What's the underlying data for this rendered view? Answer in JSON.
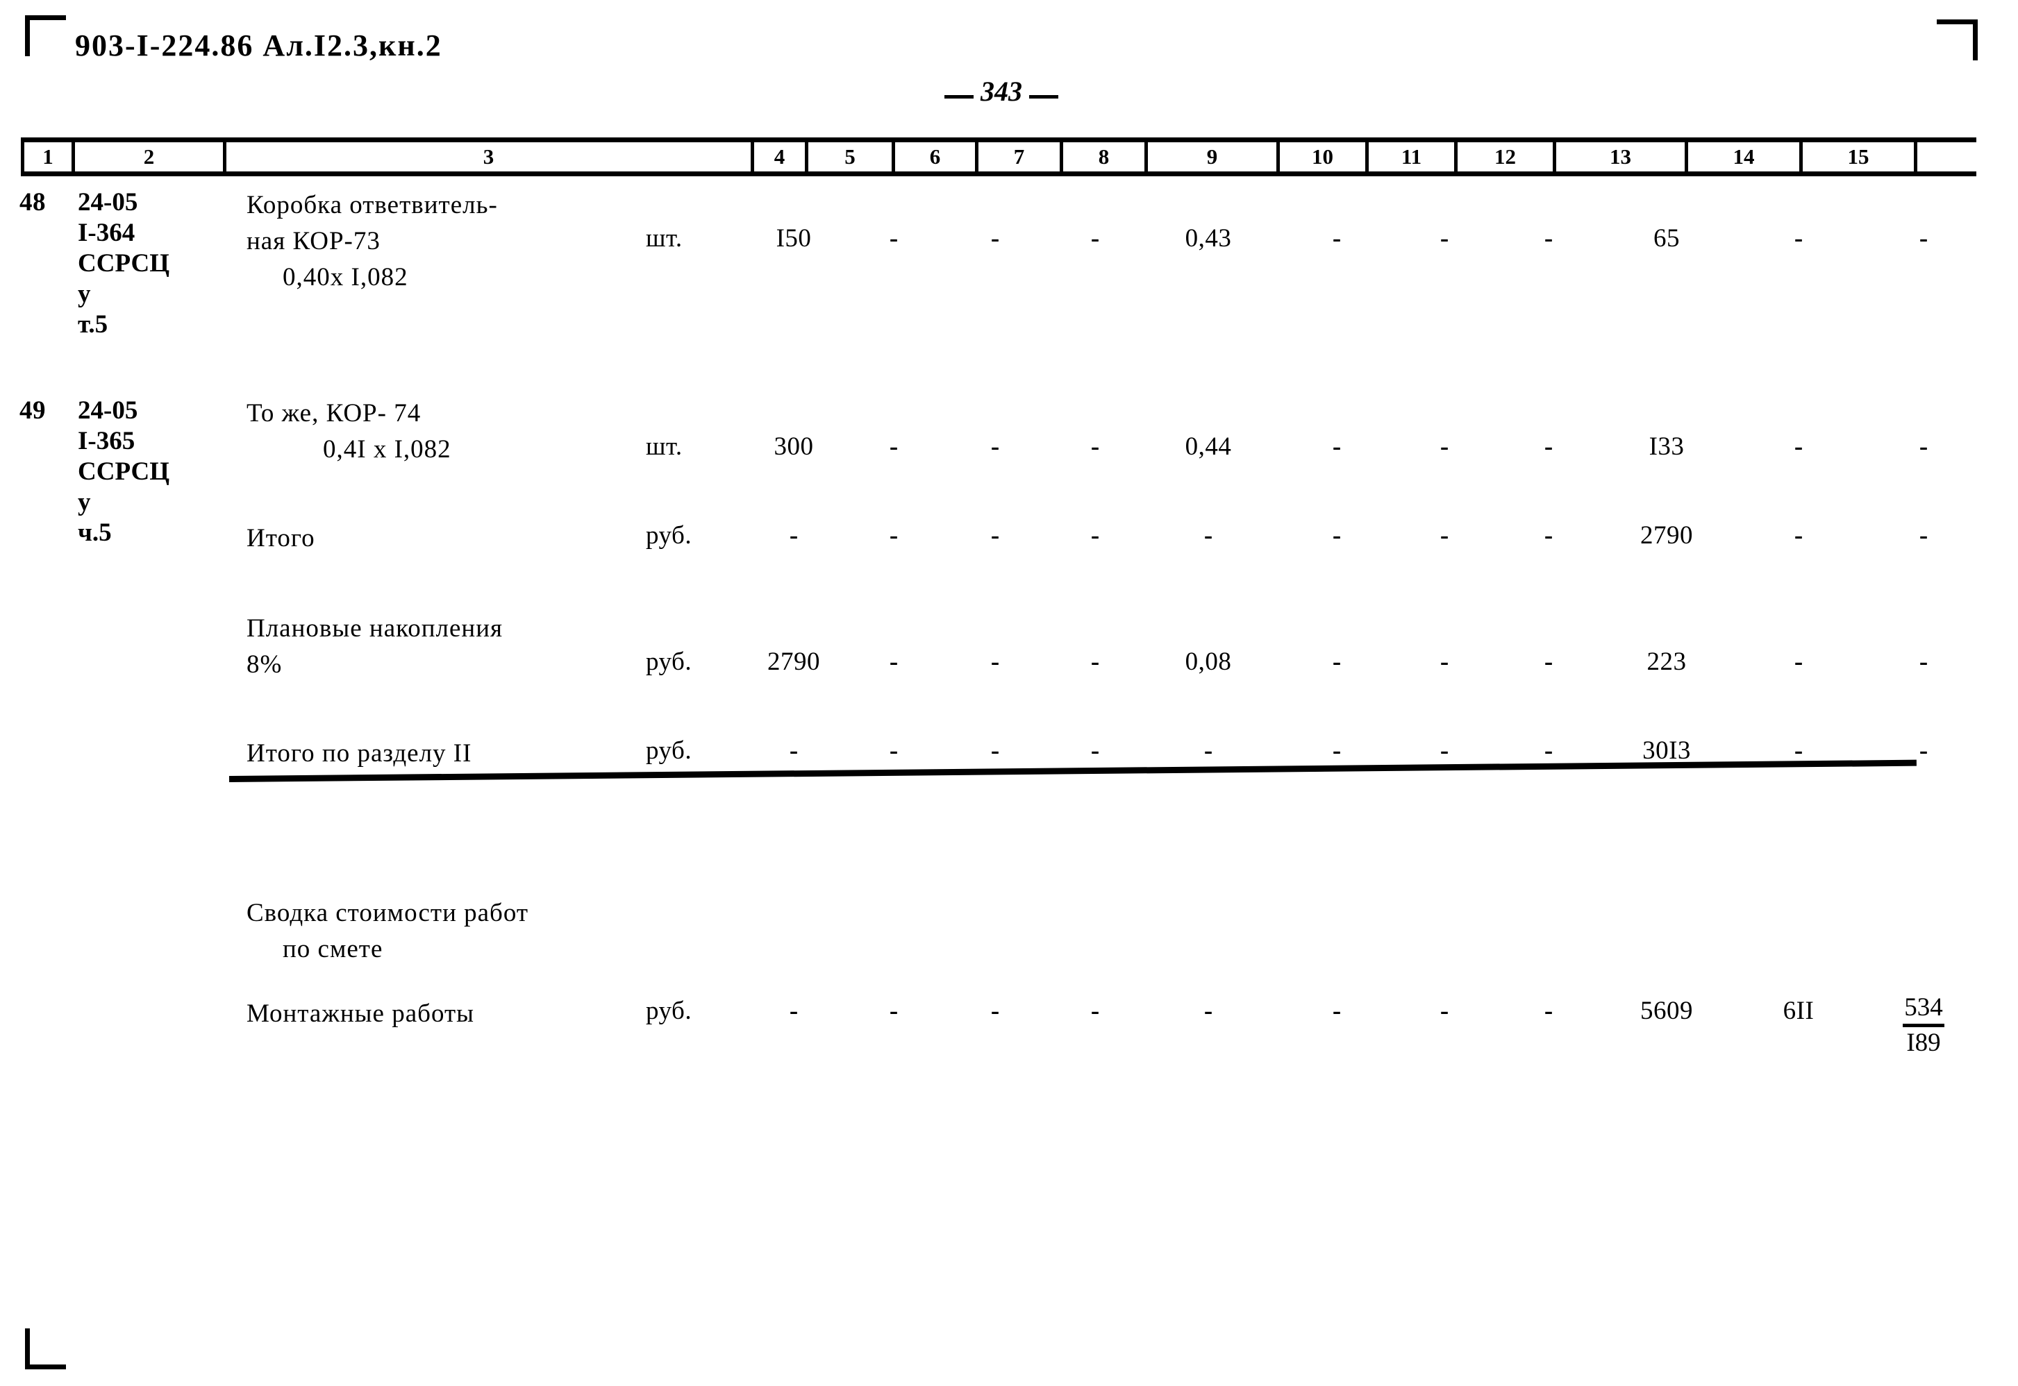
{
  "document": {
    "header_code": "903-I-224.86  Ал.I2.3,кн.2",
    "page_number": "343"
  },
  "table": {
    "column_headers": [
      "1",
      "2",
      "3",
      "4",
      "5",
      "6",
      "7",
      "8",
      "9",
      "10",
      "11",
      "12",
      "13",
      "14",
      "15"
    ],
    "rows": [
      {
        "no": "48",
        "code_lines": [
          "24-05",
          "I-364",
          "ССРСЦ",
          "у",
          "т.5"
        ],
        "desc_lines": [
          "Коробка ответвитель-",
          "ная КОР-73",
          "0,40х I,082"
        ],
        "unit": "шт.",
        "c5": "I50",
        "c6": "-",
        "c7": "-",
        "c8": "-",
        "c9": "0,43",
        "c10": "-",
        "c11": "-",
        "c12": "-",
        "c13": "65",
        "c14": "-",
        "c15": "-"
      },
      {
        "no": "49",
        "code_lines": [
          "24-05",
          "I-365",
          "ССРСЦ",
          "у",
          "ч.5"
        ],
        "desc_lines": [
          "То же, КОР- 74",
          "0,4I x I,082"
        ],
        "unit": "шт.",
        "c5": "300",
        "c6": "-",
        "c7": "-",
        "c8": "-",
        "c9": "0,44",
        "c10": "-",
        "c11": "-",
        "c12": "-",
        "c13": "I33",
        "c14": "-",
        "c15": "-"
      },
      {
        "no": "",
        "code_lines": [],
        "desc_lines": [
          "Итого"
        ],
        "unit": "руб.",
        "c5": "-",
        "c6": "-",
        "c7": "-",
        "c8": "-",
        "c9": "-",
        "c10": "-",
        "c11": "-",
        "c12": "-",
        "c13": "2790",
        "c14": "-",
        "c15": "-"
      },
      {
        "no": "",
        "code_lines": [],
        "desc_lines": [
          "Плановые накопления",
          "8%"
        ],
        "unit": "руб.",
        "c5": "2790",
        "c6": "-",
        "c7": "-",
        "c8": "-",
        "c9": "0,08",
        "c10": "-",
        "c11": "-",
        "c12": "-",
        "c13": "223",
        "c14": "-",
        "c15": "-"
      },
      {
        "no": "",
        "code_lines": [],
        "desc_lines": [
          "Итого по разделу II"
        ],
        "unit": "руб.",
        "c5": "-",
        "c6": "-",
        "c7": "-",
        "c8": "-",
        "c9": "-",
        "c10": "-",
        "c11": "-",
        "c12": "-",
        "c13": "30I3",
        "c14": "-",
        "c15": "-"
      },
      {
        "no": "",
        "code_lines": [],
        "desc_lines": [
          "Сводка стоимости работ",
          "по смете"
        ],
        "unit": "",
        "c5": "",
        "c6": "",
        "c7": "",
        "c8": "",
        "c9": "",
        "c10": "",
        "c11": "",
        "c12": "",
        "c13": "",
        "c14": "",
        "c15": ""
      },
      {
        "no": "",
        "code_lines": [],
        "desc_lines": [
          "Монтажные работы"
        ],
        "unit": "руб.",
        "c5": "-",
        "c6": "-",
        "c7": "-",
        "c8": "-",
        "c9": "-",
        "c10": "-",
        "c11": "-",
        "c12": "-",
        "c13": "5609",
        "c14": "6II",
        "c15_fraction_top": "534",
        "c15_fraction_bottom": "I89"
      }
    ]
  }
}
